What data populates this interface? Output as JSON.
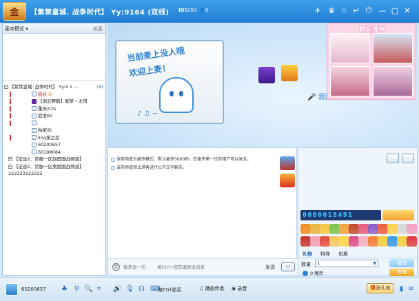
{
  "titlebar": {
    "logo_text": "金",
    "title": "【紫禁皇城. 战争时代】 Yy:9164 (双线)",
    "room_id_label": "ID",
    "room_id": "5050",
    "online_count": "9",
    "icons": [
      "flight-icon",
      "shirt-icon",
      "star-icon",
      "back-icon",
      "power-icon",
      "minimize-icon",
      "maximize-icon",
      "close-icon"
    ]
  },
  "left": {
    "mode_label": "麦序模式",
    "grab_label": "抢麦",
    "tree": [
      {
        "type": "channel",
        "text": "【紫禁皇城. 战争时代】 Yy:9 1 ...",
        "badge": "(9)"
      },
      {
        "type": "user",
        "text": "猫妖",
        "red": true,
        "marker": "red",
        "suffix": "Q"
      },
      {
        "type": "user",
        "text": "【闲云野鹤】紫禁丶太阳",
        "marker": "red",
        "vip": true
      },
      {
        "type": "user",
        "text": "重庆zt2s",
        "marker": "red"
      },
      {
        "type": "user",
        "text": "屁倌60",
        "marker": "red"
      },
      {
        "type": "user",
        "text": "",
        "marker": "red"
      },
      {
        "type": "user",
        "text": "独家ID",
        "marker": ""
      },
      {
        "type": "user",
        "text": "ling排之恋",
        "marker": "red"
      },
      {
        "type": "user",
        "text": "60200657",
        "marker": ""
      },
      {
        "type": "user",
        "text": "60198084",
        "marker": ""
      },
      {
        "type": "sub",
        "text": "【征途2．赏服一区赵国国战频道】"
      },
      {
        "type": "sub",
        "text": "【征途2．赏服一区吴国国战频道】"
      },
      {
        "type": "plain",
        "text": "222222222222"
      }
    ]
  },
  "stage": {
    "screen_line1": "当前麦上没人哦",
    "screen_line2": "欢迎上麦！",
    "mic_text": "我要上麦",
    "recommend_title": "精彩推荐"
  },
  "chat": {
    "messages": [
      "当前频道为麦序模式，默认麦序3600秒，在麦序第一位的用户可以发言。",
      "当前频道禁止游客进行公开文字聊天。"
    ],
    "input_placeholder": "我来说一句        按Ctrl+回车键发送消息",
    "send_label": "发送",
    "send_button": "↵"
  },
  "gift": {
    "counter": "0000018491",
    "tabs": [
      "礼物",
      "特殊",
      "包裹"
    ],
    "qty_label": "数量",
    "qty_value": "1",
    "give_button": "赠送",
    "coin_value": "0",
    "coin_label": "嘟币",
    "recharge_button": "充值"
  },
  "status": {
    "my_id": "60200657",
    "ctrl_talk": "按Ctrl说话",
    "play_accompany": "播放伴奏",
    "record": "录音",
    "send_gift": "送礼物",
    "colors": {
      "accent": "#1f7dd2",
      "titlebar": "#3ea0ea"
    }
  }
}
